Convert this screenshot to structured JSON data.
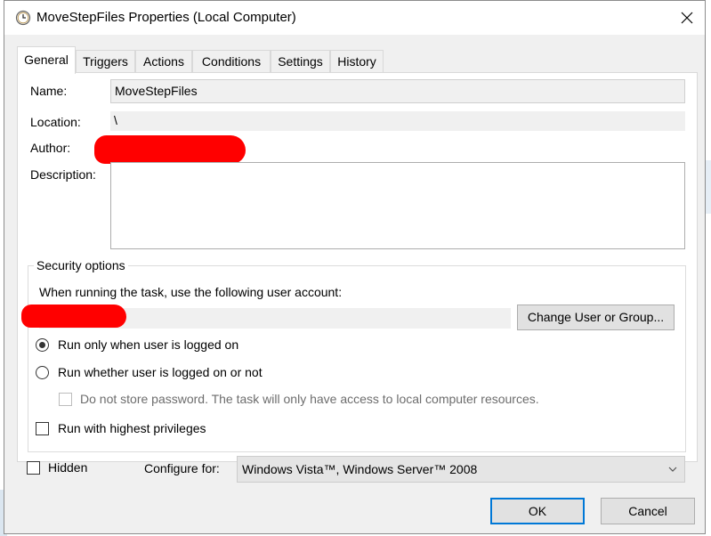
{
  "window": {
    "title": "MoveStepFiles Properties (Local Computer)",
    "icon": "clock-icon",
    "close_icon": "close-icon"
  },
  "tabs": [
    {
      "label": "General",
      "active": true
    },
    {
      "label": "Triggers",
      "active": false
    },
    {
      "label": "Actions",
      "active": false
    },
    {
      "label": "Conditions",
      "active": false
    },
    {
      "label": "Settings",
      "active": false
    },
    {
      "label": "History",
      "active": false
    }
  ],
  "general": {
    "name_label": "Name:",
    "name_value": "MoveStepFiles",
    "location_label": "Location:",
    "location_value": "\\",
    "author_label": "Author:",
    "description_label": "Description:",
    "description_value": ""
  },
  "security": {
    "group_title": "Security options",
    "account_prompt": "When running the task, use the following user account:",
    "change_button": "Change User or Group...",
    "radio_logged_on": "Run only when user is logged on",
    "radio_logged_on_checked": true,
    "radio_whether": "Run whether user is logged on or not",
    "radio_whether_checked": false,
    "no_store_password": "Do not store password.  The task will only have access to local computer resources.",
    "highest_privileges": "Run with highest privileges",
    "highest_privileges_checked": false
  },
  "footer": {
    "hidden_label": "Hidden",
    "hidden_checked": false,
    "configure_label": "Configure for:",
    "configure_value": "Windows Vista™, Windows Server™ 2008"
  },
  "buttons": {
    "ok": "OK",
    "cancel": "Cancel"
  },
  "colors": {
    "accent": "#0078d7",
    "redaction": "#ff0000"
  }
}
